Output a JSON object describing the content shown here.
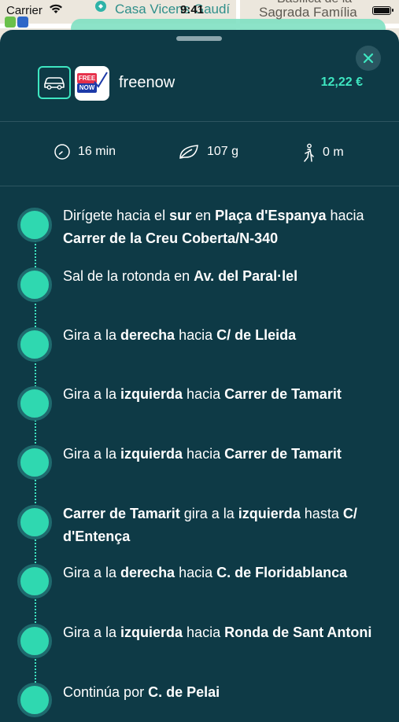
{
  "status_bar": {
    "carrier": "Carrier",
    "time": "9:41"
  },
  "map": {
    "poi_label": "Casa Vicens Gaudí",
    "label_top": "Basílica de la",
    "label_sagrada": "Sagrada Família",
    "route_color": "#7fe0c2"
  },
  "ride": {
    "provider": "freenow",
    "logo_text_top": "FREE",
    "logo_text_bottom": "NOW",
    "price": "12,22 €",
    "vehicle_icon": "car-icon",
    "accent_color": "#3ee6c1"
  },
  "stats": {
    "duration": "16 min",
    "co2": "107 g",
    "walk": "0 m"
  },
  "steps": [
    {
      "parts": [
        {
          "t": "Dirígete hacia el ",
          "b": false
        },
        {
          "t": "sur",
          "b": true
        },
        {
          "t": " en ",
          "b": false
        },
        {
          "t": "Plaça d'Espanya",
          "b": true
        },
        {
          "t": " hacia ",
          "b": false
        },
        {
          "t": "Carrer de la Creu Coberta/N-340",
          "b": true
        }
      ]
    },
    {
      "parts": [
        {
          "t": "Sal de la rotonda en ",
          "b": false
        },
        {
          "t": "Av. del Paral·lel",
          "b": true
        }
      ]
    },
    {
      "parts": [
        {
          "t": "Gira a la ",
          "b": false
        },
        {
          "t": "derecha",
          "b": true
        },
        {
          "t": " hacia ",
          "b": false
        },
        {
          "t": "C/ de Lleida",
          "b": true
        }
      ]
    },
    {
      "parts": [
        {
          "t": "Gira a la ",
          "b": false
        },
        {
          "t": "izquierda",
          "b": true
        },
        {
          "t": " hacia ",
          "b": false
        },
        {
          "t": "Carrer de Tamarit",
          "b": true
        }
      ]
    },
    {
      "parts": [
        {
          "t": "Gira a la ",
          "b": false
        },
        {
          "t": "izquierda",
          "b": true
        },
        {
          "t": " hacia ",
          "b": false
        },
        {
          "t": "Carrer de Tamarit",
          "b": true
        }
      ]
    },
    {
      "parts": [
        {
          "t": "Carrer de Tamarit",
          "b": true
        },
        {
          "t": " gira a la ",
          "b": false
        },
        {
          "t": "izquierda",
          "b": true
        },
        {
          "t": " hasta ",
          "b": false
        },
        {
          "t": "C/ d'Entença",
          "b": true
        }
      ]
    },
    {
      "parts": [
        {
          "t": "Gira a la ",
          "b": false
        },
        {
          "t": "derecha",
          "b": true
        },
        {
          "t": " hacia ",
          "b": false
        },
        {
          "t": "C. de Floridablanca",
          "b": true
        }
      ]
    },
    {
      "parts": [
        {
          "t": "Gira a la ",
          "b": false
        },
        {
          "t": "izquierda",
          "b": true
        },
        {
          "t": " hacia ",
          "b": false
        },
        {
          "t": "Ronda de Sant Antoni",
          "b": true
        }
      ]
    },
    {
      "parts": [
        {
          "t": "Continúa por ",
          "b": false
        },
        {
          "t": "C. de Pelai",
          "b": true
        }
      ]
    }
  ]
}
